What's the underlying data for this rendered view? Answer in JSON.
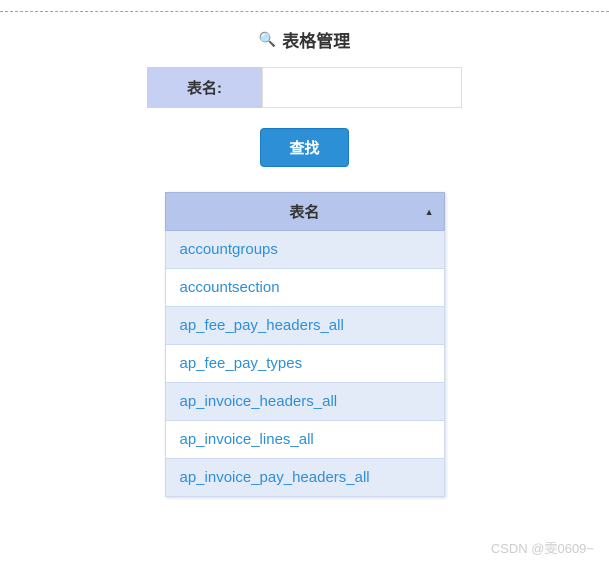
{
  "header": {
    "title": "表格管理",
    "search_icon": "🔍"
  },
  "form": {
    "table_name_label": "表名:",
    "table_name_value": "",
    "search_button_label": "查找"
  },
  "table": {
    "column_header": "表名",
    "sort_indicator": "▲",
    "rows": [
      "accountgroups",
      "accountsection",
      "ap_fee_pay_headers_all",
      "ap_fee_pay_types",
      "ap_invoice_headers_all",
      "ap_invoice_lines_all",
      "ap_invoice_pay_headers_all"
    ]
  },
  "watermark": "CSDN @雯0609~"
}
